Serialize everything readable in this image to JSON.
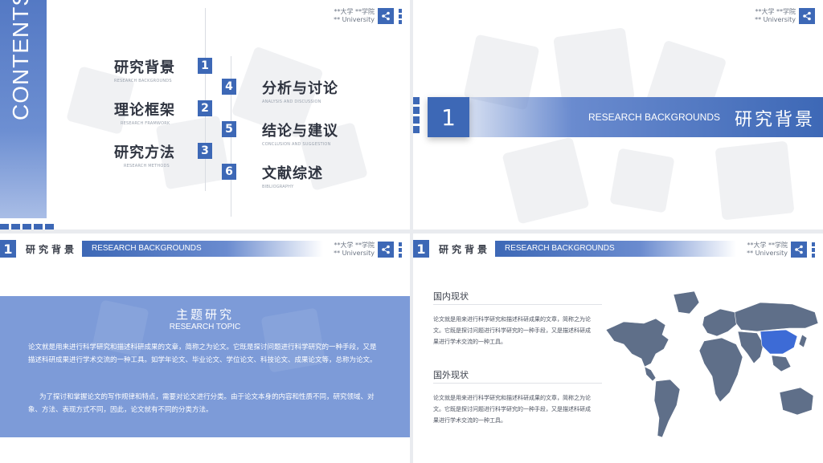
{
  "brand": {
    "line1": "**大学 **学院",
    "line2": "** University"
  },
  "slide1": {
    "contents_word": "CONTENTS",
    "items": [
      {
        "num": "1",
        "cn": "研究背景",
        "en": "RESEARCH BACKGROUNDS"
      },
      {
        "num": "2",
        "cn": "理论框架",
        "en": "RESEARCH FRAMWORK"
      },
      {
        "num": "3",
        "cn": "研究方法",
        "en": "RESEARCH METHODS"
      },
      {
        "num": "4",
        "cn": "分析与讨论",
        "en": "ANALYSIS AND DISCUSSION"
      },
      {
        "num": "5",
        "cn": "结论与建议",
        "en": "CONCLUSION AND SUGGESTION"
      },
      {
        "num": "6",
        "cn": "文献综述",
        "en": "BIBLIOGRAPHY"
      }
    ]
  },
  "slide2": {
    "num": "1",
    "en": "RESEARCH BACKGROUNDS",
    "cn": "研究背景"
  },
  "header": {
    "num": "1",
    "cn": "研究背景",
    "en": "RESEARCH BACKGROUNDS"
  },
  "slide3": {
    "title": "主题研究",
    "subtitle": "RESEARCH TOPIC",
    "para1": "论文就是用来进行科学研究和描述科研成果的文章，简称之为论文。它既是探讨问题进行科学研究的一种手段，又是描述科研成果进行学术交流的一种工具。如学年论文、毕业论文、学位论文、科技论文、成果论文等，总称为论文。",
    "para2": "为了探讨和掌握论文的写作规律和特点，需要对论文进行分类。由于论文本身的内容和性质不同，研究领域、对象、方法、表现方式不同，因此，论文就有不同的分类方法。"
  },
  "slide4": {
    "domestic_title": "国内现状",
    "domestic_text": "论文就是用来进行科学研究和描述科研成果的文章，简称之为论文。它既是探讨问题进行科学研究的一种手段，又是描述科研成果进行学术交流的一种工具。",
    "foreign_title": "国外现状",
    "foreign_text": "论文就是用来进行科学研究和描述科研成果的文章，简称之为论文。它既是探讨问题进行科学研究的一种手段，又是描述科研成果进行学术交流的一种工具。"
  },
  "colors": {
    "accent": "#3d68b6",
    "light_accent": "#7d9bd8",
    "map_land": "#5f6f89",
    "map_highlight": "#3d6bd6"
  }
}
